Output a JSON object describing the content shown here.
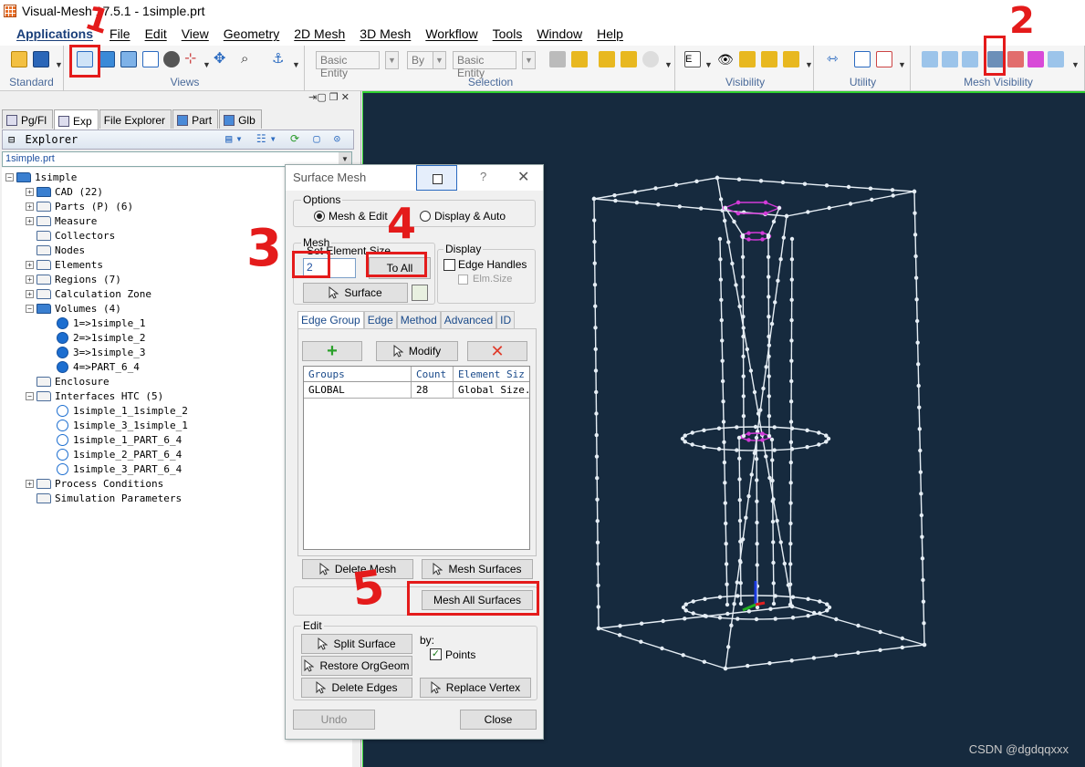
{
  "window": {
    "title": "Visual-Mesh 17.5.1 - 1simple.prt"
  },
  "menu": [
    "Applications",
    "File",
    "Edit",
    "View",
    "Geometry",
    "2D Mesh",
    "3D Mesh",
    "Workflow",
    "Tools",
    "Window",
    "Help"
  ],
  "toolbar": {
    "groups": [
      "Standard",
      "Views",
      "Selection",
      "Visibility",
      "Utility",
      "Mesh Visibility"
    ],
    "selection": {
      "filter1": "Basic Entity",
      "by": "By",
      "filter2": "Basic Entity"
    }
  },
  "left_panel": {
    "tabs": [
      "Pg/Fl",
      "Exp",
      "File Explorer",
      "Part",
      "Glb"
    ],
    "active_tab": "Exp",
    "header": "Explorer",
    "file_combo": "1simple.prt",
    "tree": [
      {
        "label": "1simple",
        "level": 0,
        "expand": "minus",
        "icon": "folder-open"
      },
      {
        "label": "CAD (22)",
        "level": 1,
        "expand": "plus",
        "icon": "folder-open"
      },
      {
        "label": "Parts (P) (6)",
        "level": 1,
        "expand": "plus",
        "icon": "folder"
      },
      {
        "label": "Measure",
        "level": 1,
        "expand": "plus",
        "icon": "folder"
      },
      {
        "label": "Collectors",
        "level": 1,
        "expand": "none",
        "icon": "folder"
      },
      {
        "label": "Nodes",
        "level": 1,
        "expand": "none",
        "icon": "folder"
      },
      {
        "label": "Elements",
        "level": 1,
        "expand": "plus",
        "icon": "folder"
      },
      {
        "label": "Regions (7)",
        "level": 1,
        "expand": "plus",
        "icon": "folder"
      },
      {
        "label": "Calculation Zone",
        "level": 1,
        "expand": "plus",
        "icon": "folder"
      },
      {
        "label": "Volumes (4)",
        "level": 1,
        "expand": "minus",
        "icon": "folder-open"
      },
      {
        "label": "1=>1simple_1",
        "level": 2,
        "expand": "none",
        "icon": "dot"
      },
      {
        "label": "2=>1simple_2",
        "level": 2,
        "expand": "none",
        "icon": "dot"
      },
      {
        "label": "3=>1simple_3",
        "level": 2,
        "expand": "none",
        "icon": "dot"
      },
      {
        "label": "4=>PART_6_4",
        "level": 2,
        "expand": "none",
        "icon": "dot"
      },
      {
        "label": "Enclosure",
        "level": 1,
        "expand": "none",
        "icon": "folder"
      },
      {
        "label": "Interfaces HTC (5)",
        "level": 1,
        "expand": "minus",
        "icon": "folder"
      },
      {
        "label": "1simple_1_1simple_2",
        "level": 2,
        "expand": "none",
        "icon": "circle"
      },
      {
        "label": "1simple_3_1simple_1",
        "level": 2,
        "expand": "none",
        "icon": "circle"
      },
      {
        "label": "1simple_1_PART_6_4",
        "level": 2,
        "expand": "none",
        "icon": "circle"
      },
      {
        "label": "1simple_2_PART_6_4",
        "level": 2,
        "expand": "none",
        "icon": "circle"
      },
      {
        "label": "1simple_3_PART_6_4",
        "level": 2,
        "expand": "none",
        "icon": "circle"
      },
      {
        "label": "Process Conditions",
        "level": 1,
        "expand": "plus",
        "icon": "folder"
      },
      {
        "label": "Simulation Parameters",
        "level": 1,
        "expand": "none",
        "icon": "folder"
      }
    ]
  },
  "dialog": {
    "title": "Surface Mesh",
    "help": "?",
    "options_legend": "Options",
    "opt_mesh_edit": "Mesh & Edit",
    "opt_display_auto": "Display & Auto",
    "mesh_legend": "Mesh",
    "set_size_label": "Set Element Size",
    "size_value": "2",
    "to_all": "To All",
    "surface_btn": "Surface",
    "display_legend": "Display",
    "edge_handles": "Edge Handles",
    "elm_size": "Elm.Size",
    "tabs": [
      "Edge Group",
      "Edge",
      "Method",
      "Advanced",
      "ID"
    ],
    "modify_btn": "Modify",
    "grid_headers": [
      "Groups",
      "Count",
      "Element Siz"
    ],
    "grid_row": [
      "GLOBAL",
      "28",
      "Global Size."
    ],
    "delete_mesh": "Delete Mesh",
    "mesh_surfaces": "Mesh Surfaces",
    "mesh_all_surfaces": "Mesh All Surfaces",
    "edit_legend": "Edit",
    "split_surface": "Split Surface",
    "restore_org_geom": "Restore OrgGeom",
    "delete_edges": "Delete Edges",
    "by_label": "by:",
    "points_label": "Points",
    "replace_vertex": "Replace Vertex",
    "undo": "Undo",
    "close": "Close"
  },
  "annotations": [
    "1",
    "2",
    "3",
    "4",
    "5"
  ],
  "watermark": "CSDN @dgdqqxxx",
  "colors": {
    "viewport_bg": "#162a3e",
    "highlight_green": "#2fd12f",
    "annotation_red": "#e41b1b",
    "mesh_white": "#e6eef5",
    "mesh_magenta": "#d23ad8"
  }
}
